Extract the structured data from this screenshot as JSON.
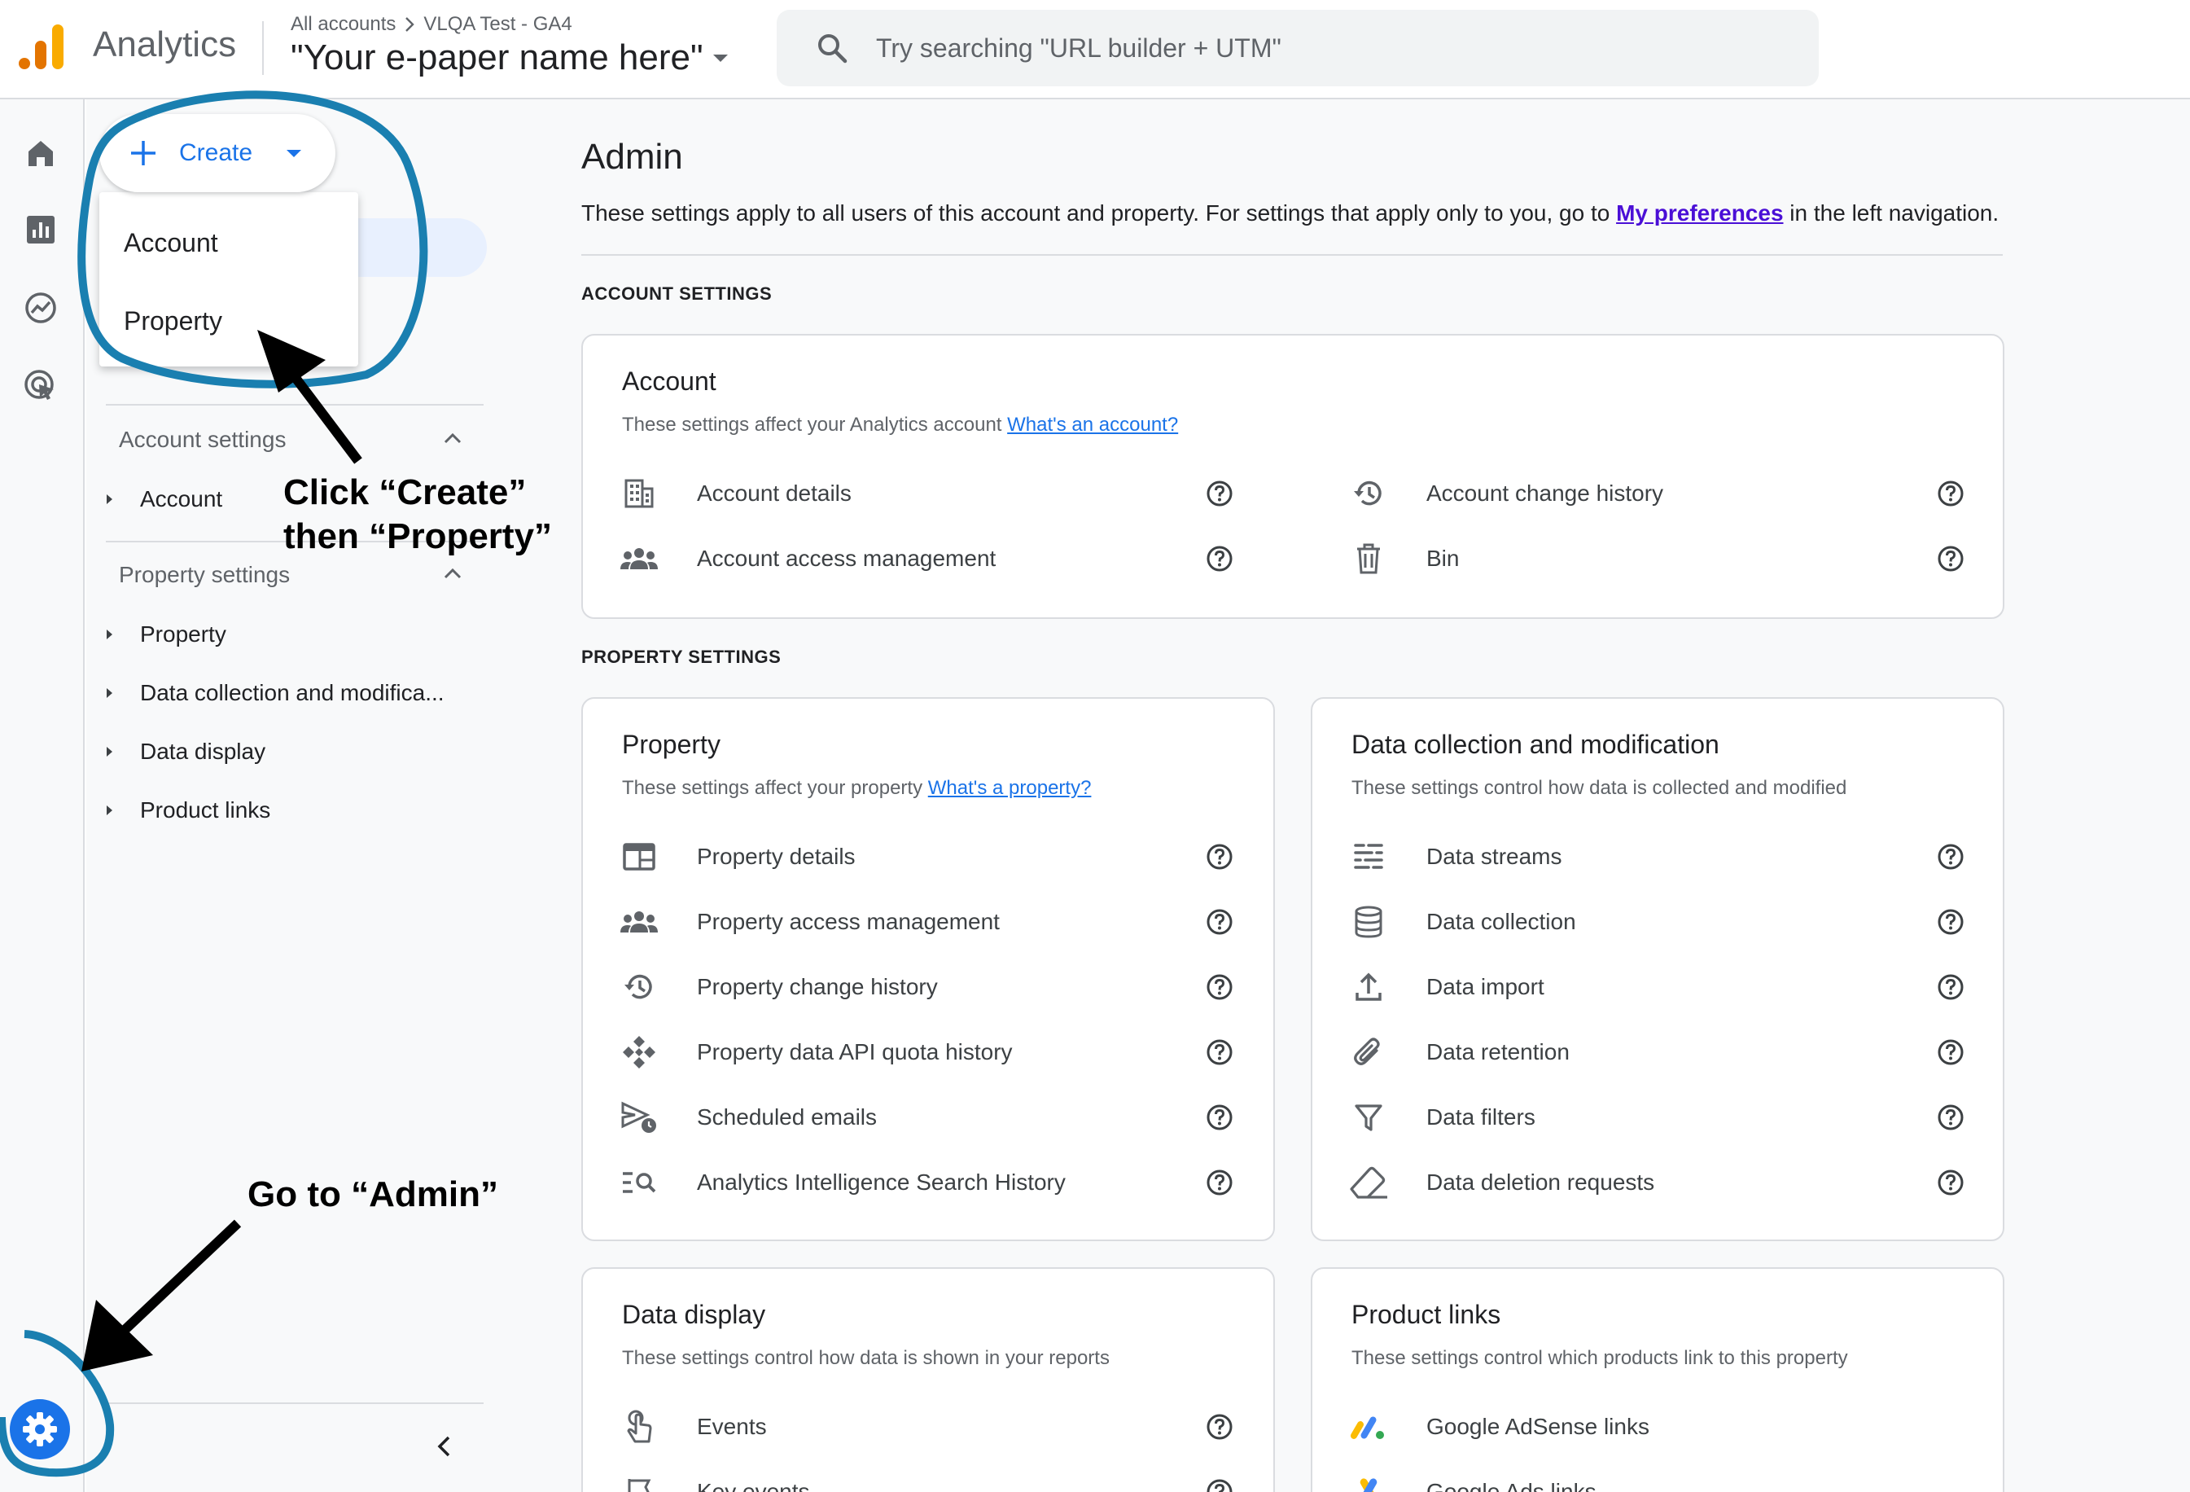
{
  "header": {
    "app_name": "Analytics",
    "breadcrumb_root": "All accounts",
    "breadcrumb_account": "VLQA Test - GA4",
    "property_name": "\"Your e-paper name here\"",
    "search_placeholder": "Try searching \"URL builder + UTM\""
  },
  "create_menu": {
    "button_label": "Create",
    "items": [
      "Account",
      "Property"
    ]
  },
  "nav": {
    "account_section": "Account settings",
    "account_items": [
      "Account"
    ],
    "property_section": "Property settings",
    "property_items": [
      "Property",
      "Data collection and modifica...",
      "Data display",
      "Product links"
    ]
  },
  "page": {
    "title": "Admin",
    "desc_prefix": "These settings apply to all users of this account and property. For settings that apply only to you, go to ",
    "desc_link": "My preferences",
    "desc_suffix": " in the left navigation."
  },
  "account_settings": {
    "label": "ACCOUNT SETTINGS",
    "card": {
      "title": "Account",
      "subtitle": "These settings affect your Analytics account ",
      "link": "What's an account?",
      "left_items": [
        "Account details",
        "Account access management"
      ],
      "right_items": [
        "Account change history",
        "Bin"
      ]
    }
  },
  "property_settings": {
    "label": "PROPERTY SETTINGS",
    "property_card": {
      "title": "Property",
      "subtitle": "These settings affect your property ",
      "link": "What's a property?",
      "items": [
        "Property details",
        "Property access management",
        "Property change history",
        "Property data API quota history",
        "Scheduled emails",
        "Analytics Intelligence Search History"
      ]
    },
    "data_card": {
      "title": "Data collection and modification",
      "subtitle": "These settings control how data is collected and modified",
      "items": [
        "Data streams",
        "Data collection",
        "Data import",
        "Data retention",
        "Data filters",
        "Data deletion requests"
      ]
    },
    "display_card": {
      "title": "Data display",
      "subtitle": "These settings control how data is shown in your reports",
      "items": [
        "Events",
        "Key events"
      ]
    },
    "links_card": {
      "title": "Product links",
      "subtitle": "These settings control which products link to this property",
      "items": [
        "Google AdSense links",
        "Google Ads links"
      ]
    }
  },
  "annotations": {
    "create_line1": "Click “Create”",
    "create_line2": "then “Property”",
    "admin_note": "Go to “Admin”"
  },
  "colors": {
    "accent_blue": "#1a73e8",
    "annotation_circle": "#1a7fb0",
    "link_purple": "#4a0fd6"
  }
}
